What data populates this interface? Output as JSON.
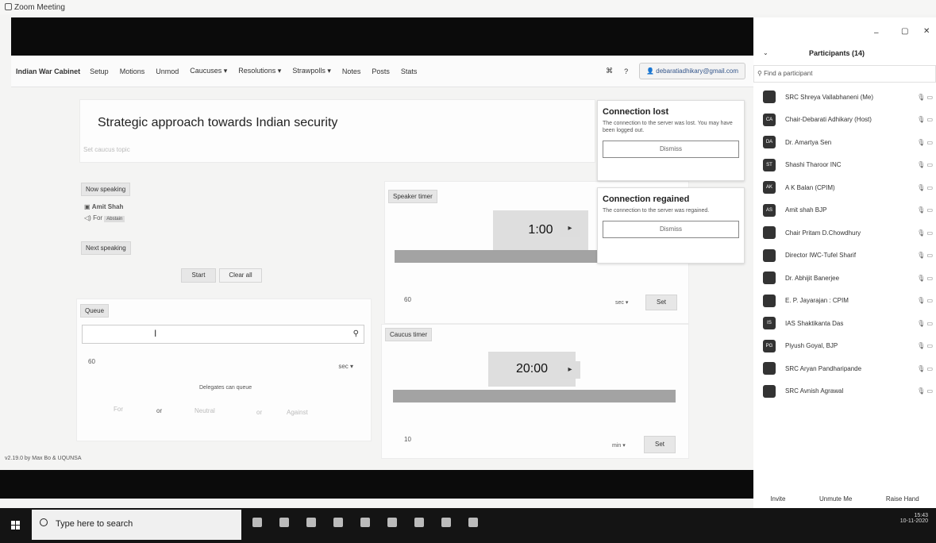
{
  "window": {
    "title": "Zoom Meeting"
  },
  "nav": {
    "brand": "Indian War Cabinet",
    "items": [
      "Setup",
      "Motions",
      "Unmod",
      "Caucuses ▾",
      "Resolutions ▾",
      "Strawpolls ▾",
      "Notes",
      "Posts",
      "Stats"
    ],
    "email": "debaratiadhikary@gmail.com"
  },
  "topic": {
    "title": "Strategic approach towards Indian security",
    "subtitle": "Set caucus topic"
  },
  "now_speaking": {
    "label": "Now speaking",
    "name": "Amit Shah",
    "stance": "For",
    "badge": "Abstain"
  },
  "next_speaking": {
    "label": "Next speaking",
    "start_label": "Start",
    "clear_label": "Clear all"
  },
  "queue": {
    "label": "Queue",
    "value": "60",
    "unit": "sec ▾",
    "delegates_label": "Delegates can queue",
    "options": [
      "For",
      "or",
      "Neutral",
      "or",
      "Against"
    ]
  },
  "speaker_timer": {
    "label": "Speaker timer",
    "time": "1:00",
    "progress_pct": 100,
    "value": "60",
    "unit": "sec ▾",
    "set_label": "Set"
  },
  "caucus_timer": {
    "label": "Caucus timer",
    "time": "20:00",
    "progress_pct": 100,
    "value": "10",
    "unit": "min ▾",
    "set_label": "Set"
  },
  "popups": [
    {
      "title": "Connection lost",
      "text": "The connection to the server was lost. You may have been logged out.",
      "button": "Dismiss"
    },
    {
      "title": "Connection regained",
      "text": "The connection to the server was regained.",
      "button": "Dismiss"
    }
  ],
  "version": "v2.19.0 by Max Bo & UQUNSA",
  "participants": {
    "title": "Participants (14)",
    "search_placeholder": "Find a participant",
    "list": [
      {
        "initials": "",
        "name": "SRC Shreya Vallabhaneni (Me)"
      },
      {
        "initials": "CA",
        "name": "Chair-Debarati Adhikary (Host)"
      },
      {
        "initials": "DA",
        "name": "Dr. Amartya Sen"
      },
      {
        "initials": "ST",
        "name": "Shashi Tharoor INC"
      },
      {
        "initials": "AK",
        "name": "A K Balan (CPIM)"
      },
      {
        "initials": "AS",
        "name": "Amit shah BJP"
      },
      {
        "initials": "",
        "name": "Chair Pritam D.Chowdhury"
      },
      {
        "initials": "",
        "name": "Director IWC-Tufel Sharif"
      },
      {
        "initials": "",
        "name": "Dr. Abhijit Banerjee"
      },
      {
        "initials": "",
        "name": "E. P. Jayarajan : CPIM"
      },
      {
        "initials": "IS",
        "name": "IAS Shaktikanta Das"
      },
      {
        "initials": "PG",
        "name": "Piyush Goyal, BJP"
      },
      {
        "initials": "",
        "name": "SRC Aryan Pandharipande"
      },
      {
        "initials": "",
        "name": "SRC Avnish Agrawal"
      }
    ],
    "footer": [
      "Invite",
      "Unmute Me",
      "Raise Hand"
    ]
  },
  "taskbar": {
    "search_placeholder": "Type here to search",
    "time": "15:43",
    "date": "10-11-2020"
  }
}
